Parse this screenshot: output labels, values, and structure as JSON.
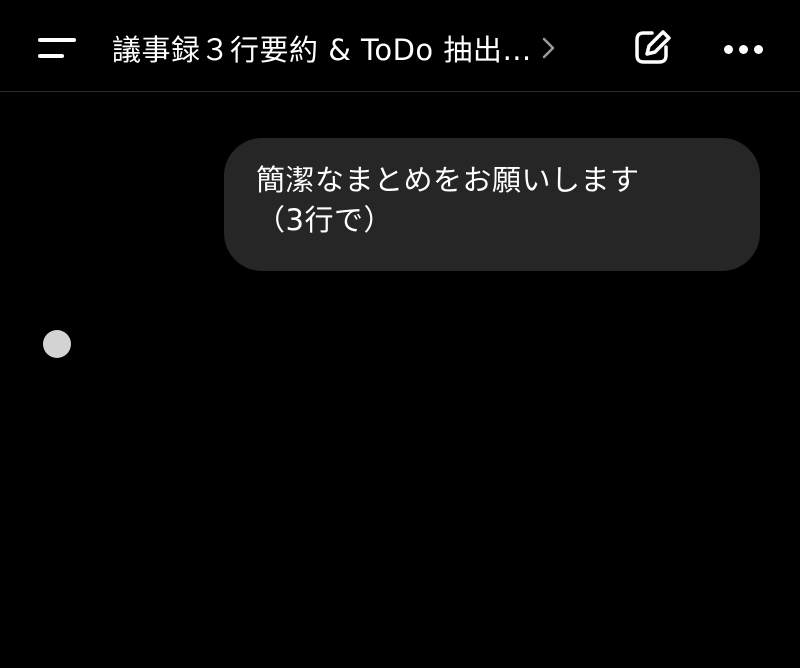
{
  "header": {
    "title": "議事録３行要約 & ToDo 抽出…",
    "menu_icon": "menu-icon",
    "chevron_icon": "chevron-right-icon",
    "edit_icon": "compose-icon",
    "more_icon": "more-icon"
  },
  "conversation": {
    "user_message": "簡潔なまとめをお願いします\n（3行で）",
    "assistant_state": "typing-indicator"
  },
  "colors": {
    "background": "#000000",
    "bubble": "#262626",
    "text": "#ffffff",
    "typing_dot": "#d3d3d3",
    "divider": "#2a2a2a"
  }
}
